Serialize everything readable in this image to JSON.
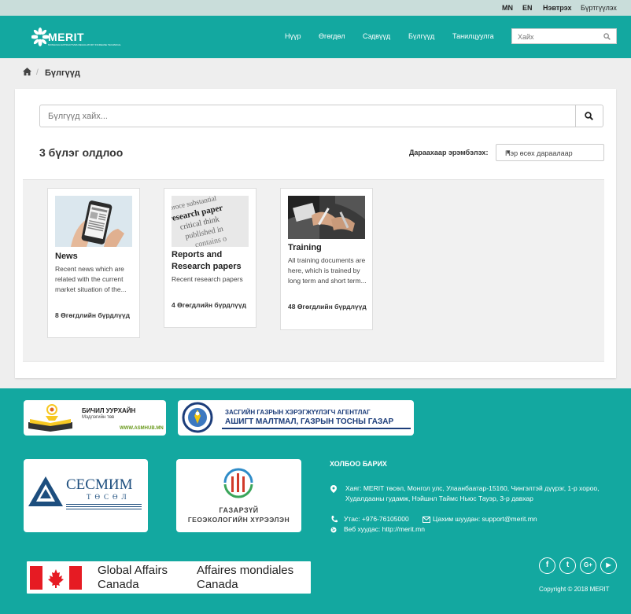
{
  "topbar": {
    "lang_mn": "MN",
    "lang_en": "EN",
    "login": "Нэвтрэх",
    "register": "Бүртгүүлэх"
  },
  "header": {
    "logo_text": "MERIT",
    "logo_sub": "MONGOLIA EXTRACTIVES REGULATORY INCREASE TECHNICAL",
    "nav": [
      "Нүүр",
      "Өгөгдөл",
      "Сэдвүүд",
      "Бүлгүүд",
      "Танилцуулга"
    ],
    "search_placeholder": "Хайх"
  },
  "breadcrumb": {
    "current": "Бүлгүүд",
    "separator": "/"
  },
  "main": {
    "search_placeholder": "Бүлгүүд хайх...",
    "result_title": "3 бүлэг олдлоо",
    "sort_label": "Дараахаар эрэмбэлэх:",
    "sort_value": "Нэр өсөх дараалаар",
    "cards": [
      {
        "title": "News",
        "desc": "Recent news which are related with the current market situation of the...",
        "count": "8 Өгөгдлийн бүрдлүүд"
      },
      {
        "title": "Reports and Research papers",
        "desc": "Recent research papers",
        "count": "4 Өгөгдлийн бүрдлүүд"
      },
      {
        "title": "Training",
        "desc": "All training documents are here, which is trained by long term and short term...",
        "count": "48 Өгөгдлийн бүрдлүүд"
      }
    ]
  },
  "footer": {
    "partners": {
      "asmhub_title": "БИЧИЛ УУРХАЙН",
      "asmhub_sub": "Мэдлэгийн төв",
      "asmhub_url": "WWW.ASMHUB.MN",
      "agency_line1": "ЗАСГИЙН ГАЗРЫН ХЭРЭГЖҮҮЛЭГЧ АГЕНТЛАГ",
      "agency_line2": "АШИГТ МАЛТМАЛ, ГАЗРЫН ТОСНЫ ГАЗАР",
      "sesmim_title": "СЕСМИМ",
      "sesmim_sub": "ТӨСӨЛ",
      "geo_line1": "ГАЗАРЗҮЙ",
      "geo_line2": "ГЕОЭКОЛОГИЙН ХҮРЭЭЛЭН",
      "gac_en1": "Global Affairs",
      "gac_en2": "Canada",
      "gac_fr1": "Affaires mondiales",
      "gac_fr2": "Canada"
    },
    "contact": {
      "title": "ХОЛБОО БАРИХ",
      "address": "Хаяг: MERIT төсөл, Монгол улс, Улаанбаатар-15160, Чингэлтэй дүүрэг, 1-р хороо, Худалдааны гудамж, Нэйшнл Таймс Ньюс Тауэр, 3-р давхар",
      "phone": "Утас: +976-76105000",
      "email": "Цахим шуудан: support@merit.mn",
      "web": "Веб хуудас: http://merit.mn"
    },
    "social": [
      "f",
      "t",
      "G+",
      "▶"
    ],
    "copyright": "Copyright © 2018 MERIT"
  }
}
